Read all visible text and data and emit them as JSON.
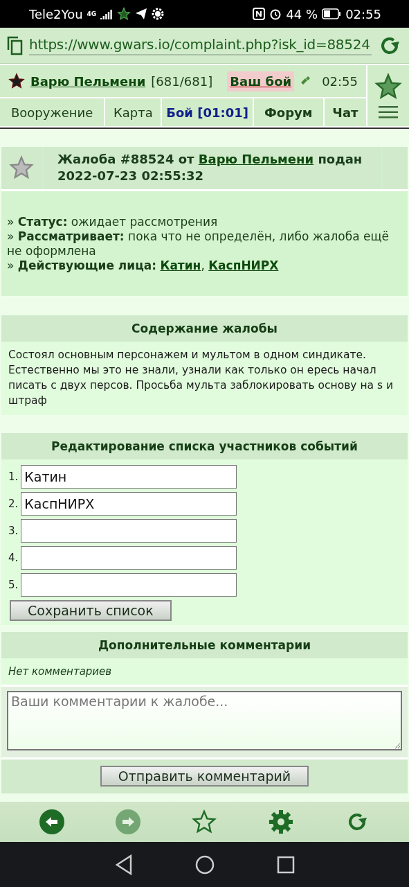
{
  "status_bar": {
    "carrier": "Tele2You",
    "network": "4G",
    "battery": "44 %",
    "time": "02:55"
  },
  "address_bar": {
    "url": "https://www.gwars.io/complaint.php?isk_id=88524"
  },
  "header": {
    "user": "Варю Пельмени",
    "hp": "[681/681]",
    "battle_alert": "Ваш бой",
    "time": "02:55"
  },
  "tabs": [
    {
      "label": "Вооружение",
      "selected": false,
      "bold": false
    },
    {
      "label": "Карта",
      "selected": false,
      "bold": false
    },
    {
      "label": "Бой [01:01]",
      "selected": true,
      "bold": true
    },
    {
      "label": "Форум",
      "selected": false,
      "bold": true
    },
    {
      "label": "Чат",
      "selected": false,
      "bold": true
    }
  ],
  "complaint": {
    "title_prefix": "Жалоба #88524 от",
    "author": "Варю Пельмени",
    "title_suffix": "подан 2022-07-23 02:55:32",
    "fields": [
      {
        "text": "» **Статус:** ожидает рассмотрения"
      },
      {
        "text": "» **Рассматривает:** пока что не определён, либо жалоба ещё не оформлена"
      }
    ],
    "participants_label": "» **Действующие лица:**",
    "participants": [
      "Катин",
      "КаспНИРХ"
    ],
    "separator": ","
  },
  "content": {
    "title": "Содержание жалобы",
    "text": "Состоял основным персонажем и мультом в одном синдикате. Естественно мы это не знали, узнали как только он ересь начал писать с двух персов. Просьба мульта заблокировать основу на s и штраф"
  },
  "edit_list": {
    "title": "Редактирование списка участников событий",
    "entries": [
      {
        "number": "1.",
        "value": "Катин"
      },
      {
        "number": "2.",
        "value": "КаспНИРХ"
      },
      {
        "number": "3."
      },
      {
        "number": "4."
      },
      {
        "number": "5."
      }
    ],
    "button": "Сохранить список"
  },
  "comments": {
    "title": "Дополнительные комментарии",
    "empty": "Нет комментариев",
    "placeholder": "Ваши комментарии к жалобе...",
    "button": "Отправить комментарий"
  },
  "bottom_nav": [
    {
      "kind": "back",
      "disabled": false
    },
    {
      "kind": "forward",
      "disabled": true
    },
    {
      "kind": "star",
      "disabled": false
    },
    {
      "kind": "settings",
      "disabled": false
    },
    {
      "kind": "reload",
      "disabled": false
    }
  ]
}
